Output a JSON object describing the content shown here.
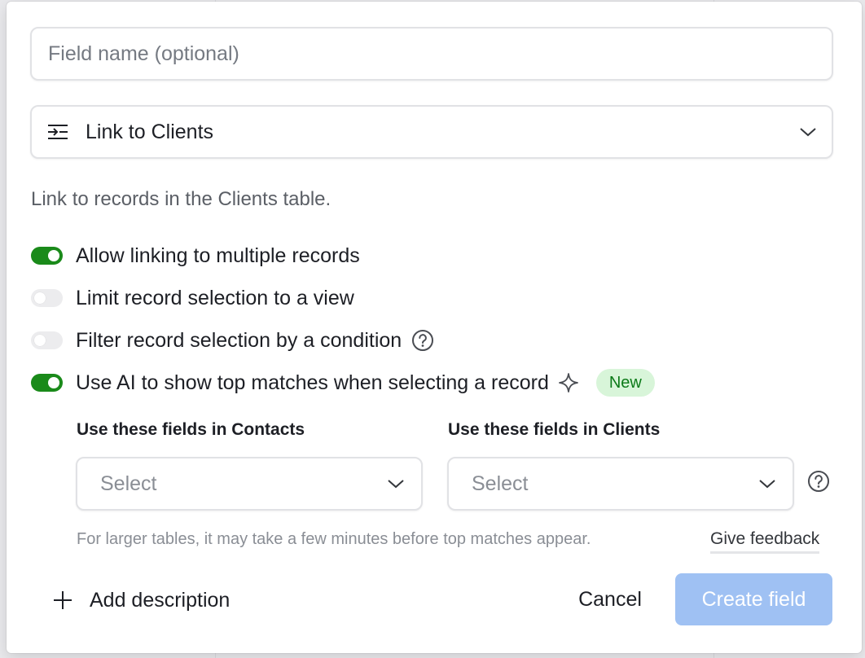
{
  "dialog": {
    "field_name": {
      "value": "",
      "placeholder": "Field name (optional)"
    },
    "field_type": {
      "label": "Link to Clients",
      "icon": "link-field-icon"
    },
    "description": "Link to records in the Clients table.",
    "options": [
      {
        "label": "Allow linking to multiple records",
        "enabled": true
      },
      {
        "label": "Limit record selection to a view",
        "enabled": false
      },
      {
        "label": "Filter record selection by a condition",
        "enabled": false,
        "help": true
      },
      {
        "label": "Use AI to show top matches when selecting a record",
        "enabled": true,
        "badge": "New"
      }
    ],
    "ai_matching": {
      "contacts_label": "Use these fields in Contacts",
      "clients_label": "Use these fields in Clients",
      "contacts_select": "Select",
      "clients_select": "Select",
      "hint": "For larger tables, it may take a few minutes before top matches appear.",
      "feedback_link": "Give feedback"
    },
    "footer": {
      "add_description": "Add description",
      "cancel": "Cancel",
      "create": "Create field"
    }
  },
  "colors": {
    "toggle_on": "#1a8a1a",
    "toggle_off": "#ececee",
    "badge_bg": "#d8f5d9",
    "badge_text": "#0b7a18",
    "primary_disabled": "#9fc1f3"
  }
}
